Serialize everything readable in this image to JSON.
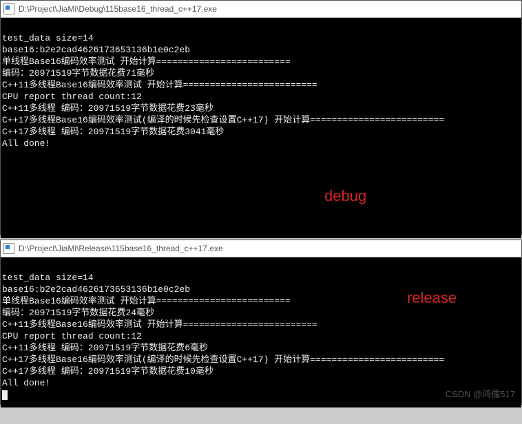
{
  "windows": [
    {
      "title": "D:\\Project\\JiaMi\\Debug\\115base16_thread_c++17.exe",
      "lines": [
        "test_data size=14",
        "base16:b2e2cad4626173653136b1e0c2eb",
        "单线程Base16编码效率测试 开始计算=========================",
        "编码：20971519字节数据花费71毫秒",
        "C++11多线程Base16编码效率测试 开始计算=========================",
        "CPU report thread count:12",
        "C++11多线程 编码：20971519字节数据花费23毫秒",
        "C++17多线程Base16编码效率测试(编译的时候先检查设置C++17) 开始计算=========================",
        "C++17多线程 编码：20971519字节数据花费3041毫秒",
        "All done!"
      ],
      "overlay": "debug",
      "overlay_style": "left:470px; top:250px;"
    },
    {
      "title": "D:\\Project\\JiaMi\\Release\\115base16_thread_c++17.exe",
      "lines": [
        "test_data size=14",
        "base16:b2e2cad4626173653136b1e0c2eb",
        "单线程Base16编码效率测试 开始计算=========================",
        "编码：20971519字节数据花费24毫秒",
        "C++11多线程Base16编码效率测试 开始计算=========================",
        "CPU report thread count:12",
        "C++11多线程 编码：20971519字节数据花费6毫秒",
        "C++17多线程Base16编码效率测试(编译的时候先检查设置C++17) 开始计算=========================",
        "C++17多线程 编码：20971519字节数据花费10毫秒",
        "All done!"
      ],
      "overlay": "release",
      "overlay_style": "left:590px; top:50px;"
    }
  ],
  "watermark": "CSDN @鸿儒517"
}
